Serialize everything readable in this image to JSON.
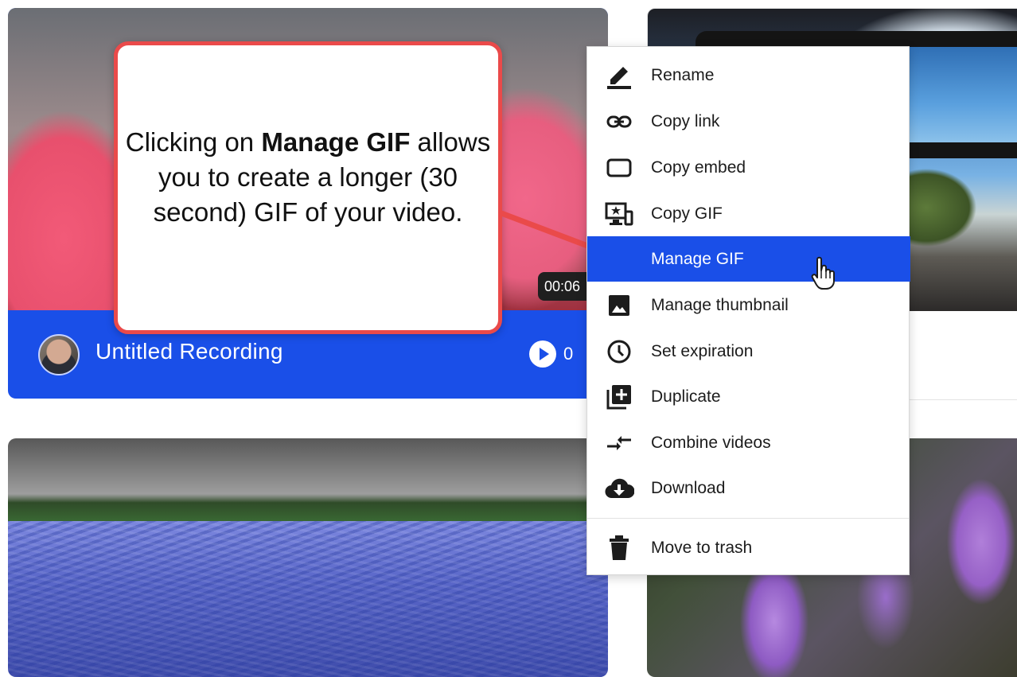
{
  "cards": [
    {
      "title": "Untitled Recording",
      "duration": "00:06",
      "views": "0",
      "thumbnail": "tulips"
    },
    {
      "thumbnail": "desktop-landscape"
    },
    {
      "thumbnail": "bluebonnet-field"
    },
    {
      "thumbnail": "lavender"
    }
  ],
  "callout": {
    "pre": "Clicking on ",
    "bold": "Manage GIF",
    "post": " allows you to create a longer (30 second) GIF of your video.",
    "border_color": "#ea4a4a"
  },
  "menu": {
    "items": [
      {
        "label": "Rename",
        "icon": "pencil-icon"
      },
      {
        "label": "Copy link",
        "icon": "link-icon"
      },
      {
        "label": "Copy embed",
        "icon": "embed-icon"
      },
      {
        "label": "Copy GIF",
        "icon": "gif-icon"
      },
      {
        "label": "Manage GIF",
        "icon": "none",
        "active": true
      },
      {
        "label": "Manage thumbnail",
        "icon": "image-icon"
      },
      {
        "label": "Set expiration",
        "icon": "clock-icon"
      },
      {
        "label": "Duplicate",
        "icon": "duplicate-icon"
      },
      {
        "label": "Combine videos",
        "icon": "combine-icon"
      },
      {
        "label": "Download",
        "icon": "cloud-download-icon"
      },
      {
        "label": "Move to trash",
        "icon": "trash-icon"
      }
    ],
    "active_color": "#1a4fe8"
  },
  "colors": {
    "brand_blue": "#1a4fe8",
    "callout_red": "#ea4a4a"
  }
}
